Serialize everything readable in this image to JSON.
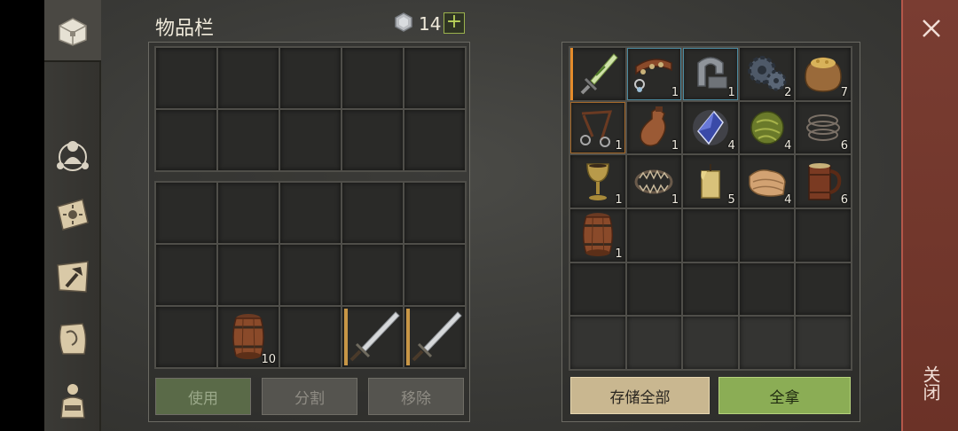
{
  "inventory": {
    "title": "物品栏",
    "coins": "14",
    "plus": "+",
    "slots_top": [],
    "slots_bottom": [
      {
        "icon": "barrel-icon",
        "count": "10"
      },
      {
        "icon": "sword-icon",
        "count": ""
      },
      {
        "icon": "sword-icon",
        "count": ""
      }
    ]
  },
  "actions": {
    "use": "使用",
    "split": "分割",
    "remove": "移除"
  },
  "container": {
    "items": [
      {
        "icon": "dagger-icon",
        "count": ""
      },
      {
        "icon": "collar-icon",
        "count": "1"
      },
      {
        "icon": "shackle-icon",
        "count": "1"
      },
      {
        "icon": "gear-icon",
        "count": "2"
      },
      {
        "icon": "grain-sack-icon",
        "count": "7"
      },
      {
        "icon": "harness-icon",
        "count": "1"
      },
      {
        "icon": "leather-bottle-icon",
        "count": "1"
      },
      {
        "icon": "crystal-icon",
        "count": "4"
      },
      {
        "icon": "moss-ball-icon",
        "count": "4"
      },
      {
        "icon": "rope-icon",
        "count": "6"
      },
      {
        "icon": "goblet-icon",
        "count": "1"
      },
      {
        "icon": "bear-trap-icon",
        "count": "1"
      },
      {
        "icon": "candle-icon",
        "count": "5"
      },
      {
        "icon": "cloth-icon",
        "count": "4"
      },
      {
        "icon": "tankard-icon",
        "count": "6"
      },
      {
        "icon": "barrel-icon",
        "count": "1"
      }
    ],
    "store_all": "存储全部",
    "take_all": "全拿"
  },
  "close": {
    "label": "关闭"
  },
  "colors": {
    "accent_green": "#8bad55",
    "accent_beige": "#c9b790",
    "close_red": "#6b3227"
  }
}
